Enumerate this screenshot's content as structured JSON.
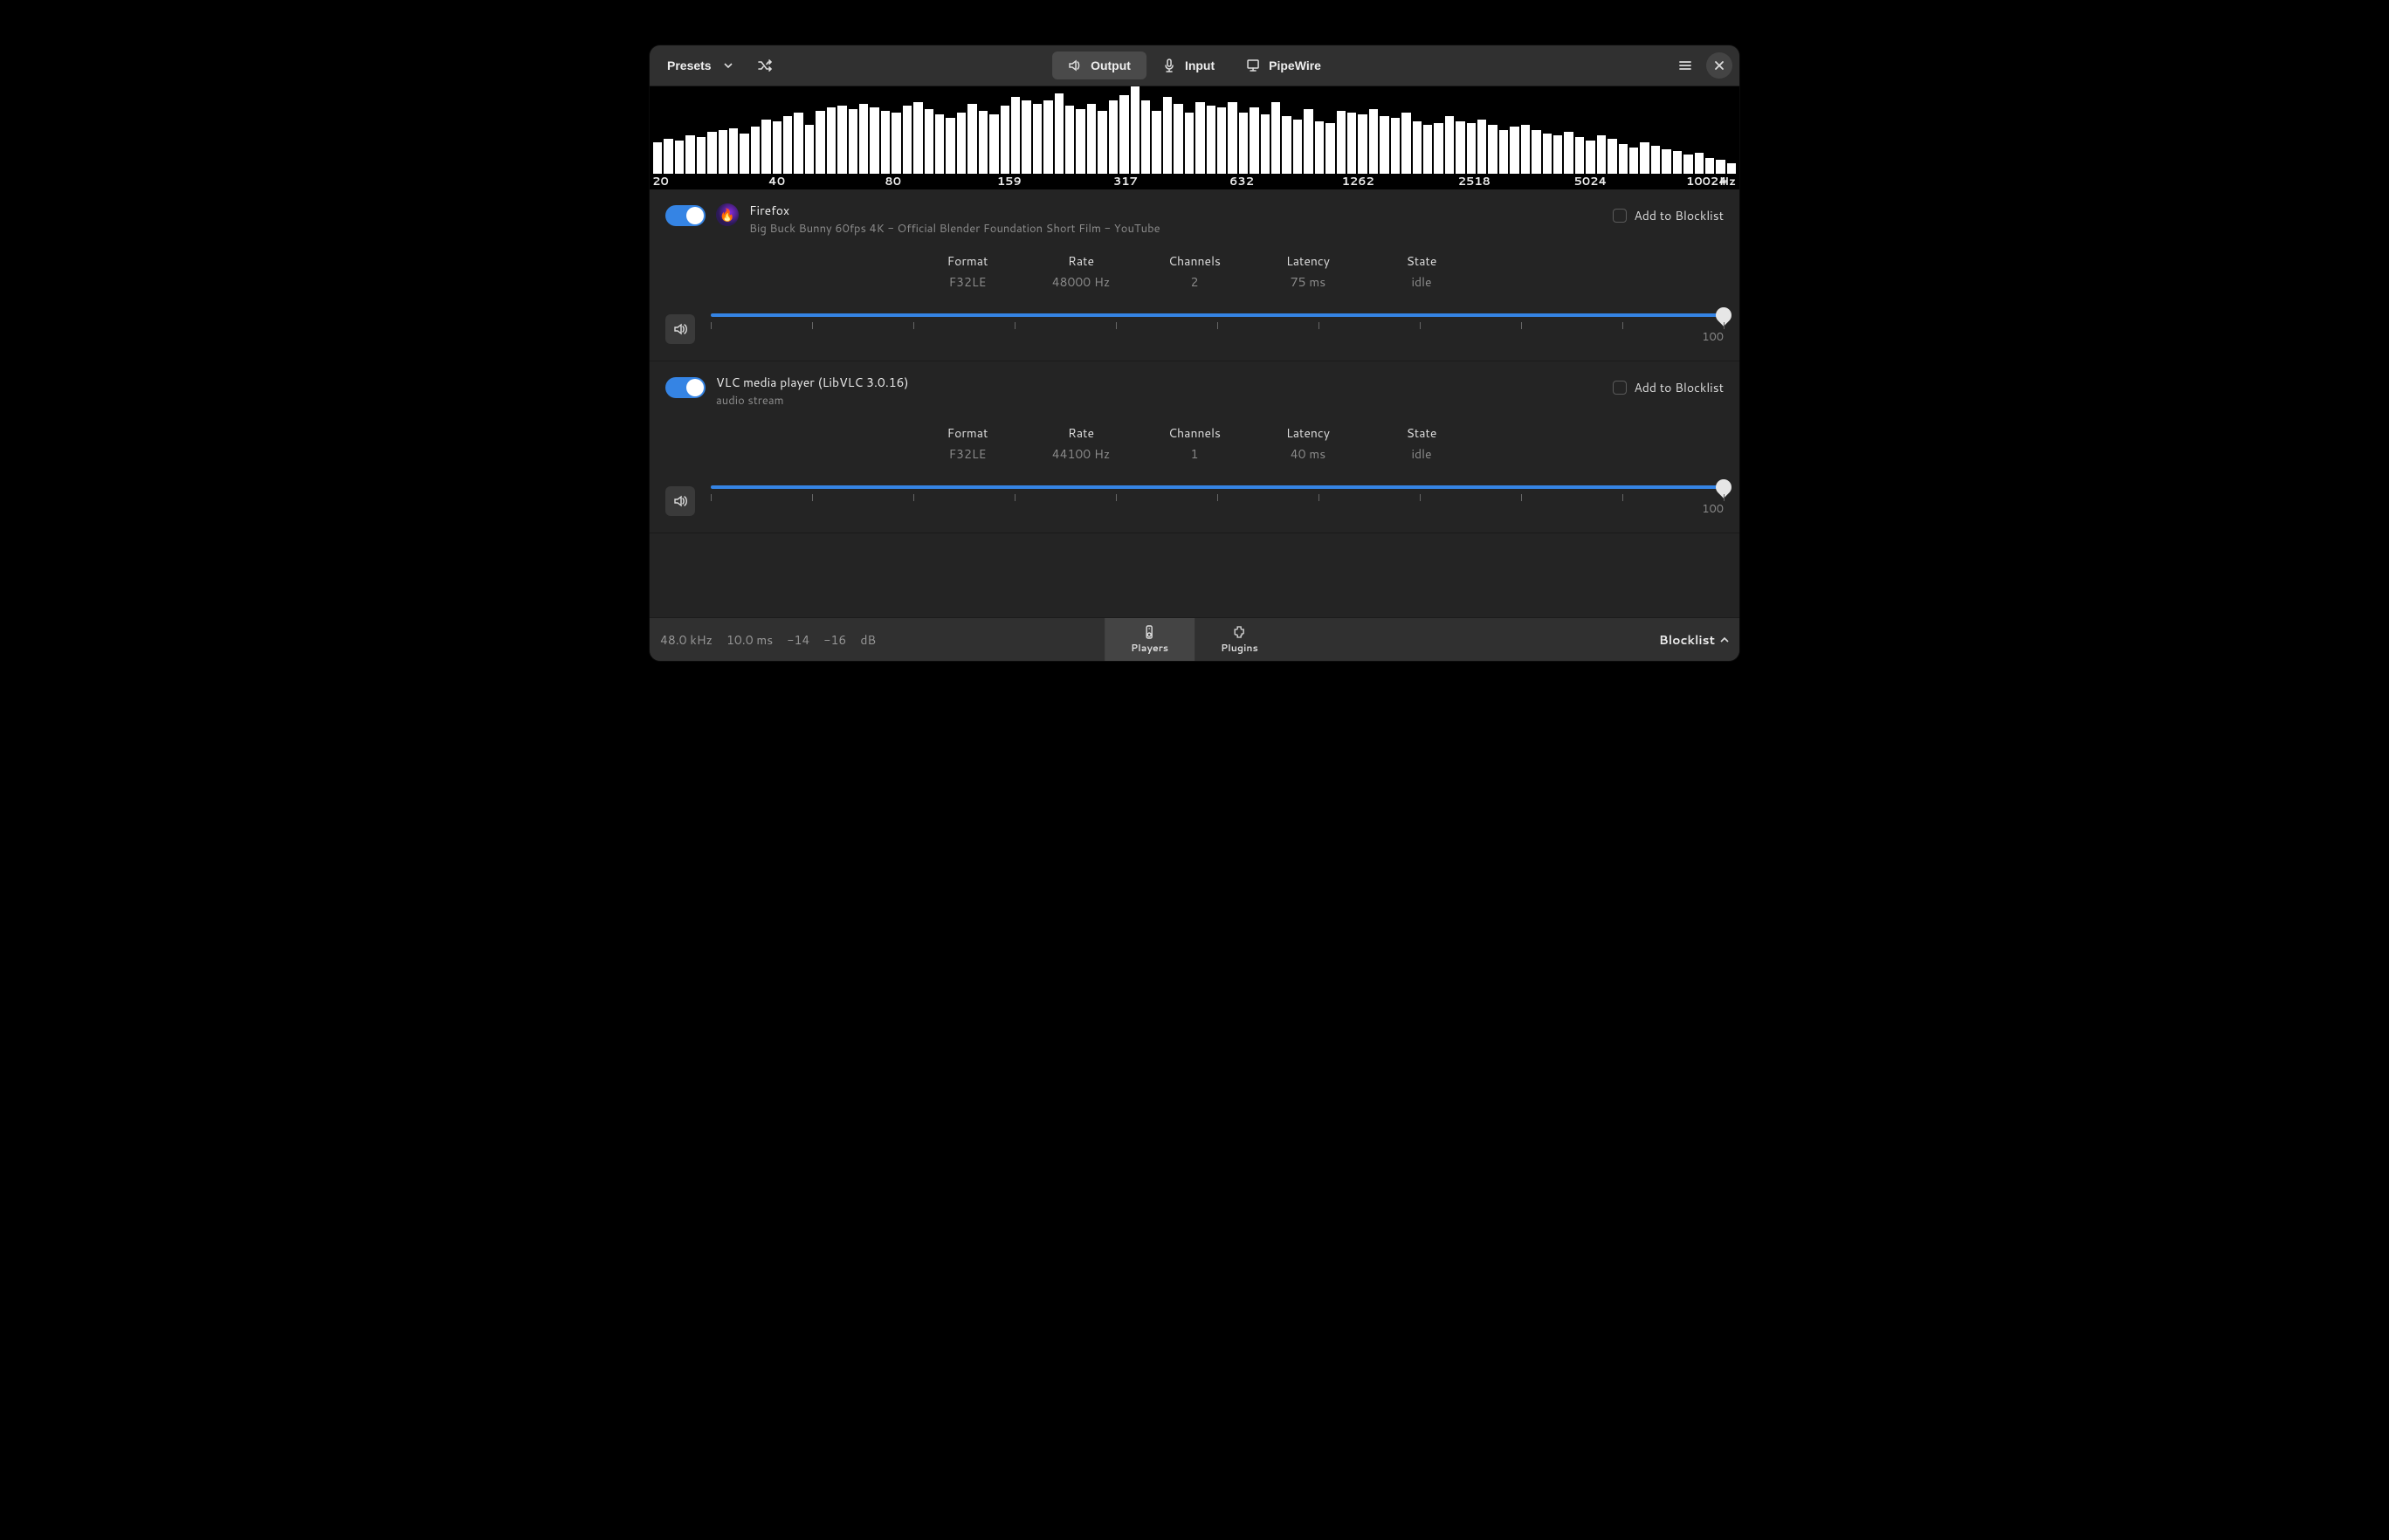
{
  "header": {
    "presets_label": "Presets",
    "tabs": {
      "output": "Output",
      "input": "Input",
      "pipewire": "PipeWire"
    }
  },
  "spectrum": {
    "freq_labels": [
      "20",
      "40",
      "80",
      "159",
      "317",
      "632",
      "1262",
      "2518",
      "5024",
      "10024"
    ],
    "hz_label": "Hz",
    "bars": [
      36,
      40,
      38,
      44,
      42,
      48,
      50,
      52,
      46,
      54,
      62,
      60,
      66,
      70,
      56,
      72,
      76,
      78,
      74,
      80,
      76,
      72,
      70,
      78,
      82,
      74,
      68,
      64,
      70,
      80,
      72,
      68,
      78,
      88,
      84,
      80,
      84,
      92,
      78,
      74,
      80,
      72,
      84,
      90,
      100,
      84,
      72,
      88,
      80,
      70,
      82,
      78,
      76,
      82,
      70,
      76,
      68,
      82,
      66,
      62,
      74,
      60,
      58,
      72,
      70,
      68,
      74,
      66,
      64,
      70,
      60,
      56,
      58,
      66,
      60,
      58,
      62,
      56,
      50,
      54,
      56,
      50,
      46,
      44,
      48,
      42,
      38,
      44,
      40,
      34,
      30,
      36,
      32,
      28,
      26,
      22,
      24,
      18,
      16,
      12
    ]
  },
  "players": [
    {
      "name": "Firefox",
      "subtitle": "Big Buck Bunny 60fps 4K - Official Blender Foundation Short Film - YouTube",
      "icon": "firefox",
      "blocklist_label": "Add to Blocklist",
      "stats": {
        "format_label": "Format",
        "format_value": "F32LE",
        "rate_label": "Rate",
        "rate_value": "48000 Hz",
        "channels_label": "Channels",
        "channels_value": "2",
        "latency_label": "Latency",
        "latency_value": "75 ms",
        "state_label": "State",
        "state_value": "idle"
      },
      "volume": "100"
    },
    {
      "name": "VLC media player (LibVLC 3.0.16)",
      "subtitle": "audio stream",
      "icon": "none",
      "blocklist_label": "Add to Blocklist",
      "stats": {
        "format_label": "Format",
        "format_value": "F32LE",
        "rate_label": "Rate",
        "rate_value": "44100 Hz",
        "channels_label": "Channels",
        "channels_value": "1",
        "latency_label": "Latency",
        "latency_value": "40 ms",
        "state_label": "State",
        "state_value": "idle"
      },
      "volume": "100"
    }
  ],
  "footer": {
    "sample_rate": "48.0 kHz",
    "latency": "10.0 ms",
    "level_l": "-14",
    "level_r": "-16",
    "unit": "dB",
    "tabs": {
      "players": "Players",
      "plugins": "Plugins"
    },
    "blocklist_label": "Blocklist"
  }
}
